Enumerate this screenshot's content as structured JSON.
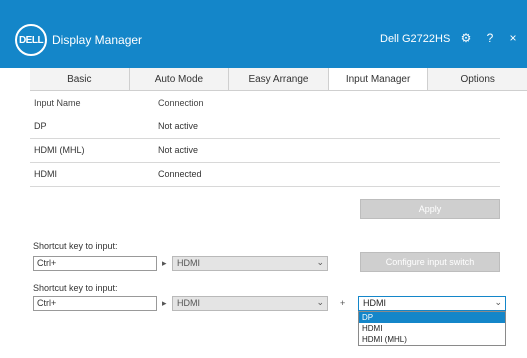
{
  "app": {
    "logo_text": "DELL",
    "title": "Display Manager",
    "model": "Dell G2722HS",
    "controls": {
      "settings": "⚙",
      "help": "?",
      "close": "×"
    }
  },
  "tabs": [
    {
      "label": "Basic"
    },
    {
      "label": "Auto Mode"
    },
    {
      "label": "Easy Arrange"
    },
    {
      "label": "Input Manager"
    },
    {
      "label": "Options"
    }
  ],
  "inputs_table": {
    "col_name": "Input Name",
    "col_status": "Connection",
    "rows": [
      {
        "name": "DP",
        "status": "Not active"
      },
      {
        "name": "HDMI (MHL)",
        "status": "Not active"
      },
      {
        "name": "HDMI",
        "status": "Connected"
      }
    ]
  },
  "buttons": {
    "apply": "Apply",
    "configure": "Configure input switch"
  },
  "hotkey1": {
    "label": "Shortcut key to input:",
    "key": "Ctrl+",
    "value": "HDMI"
  },
  "hotkey2": {
    "label": "Shortcut key to input:",
    "key": "Ctrl+",
    "value": "HDMI",
    "separator": "+",
    "selected": "HDMI",
    "options": [
      "DP",
      "HDMI",
      "HDMI (MHL)"
    ]
  }
}
